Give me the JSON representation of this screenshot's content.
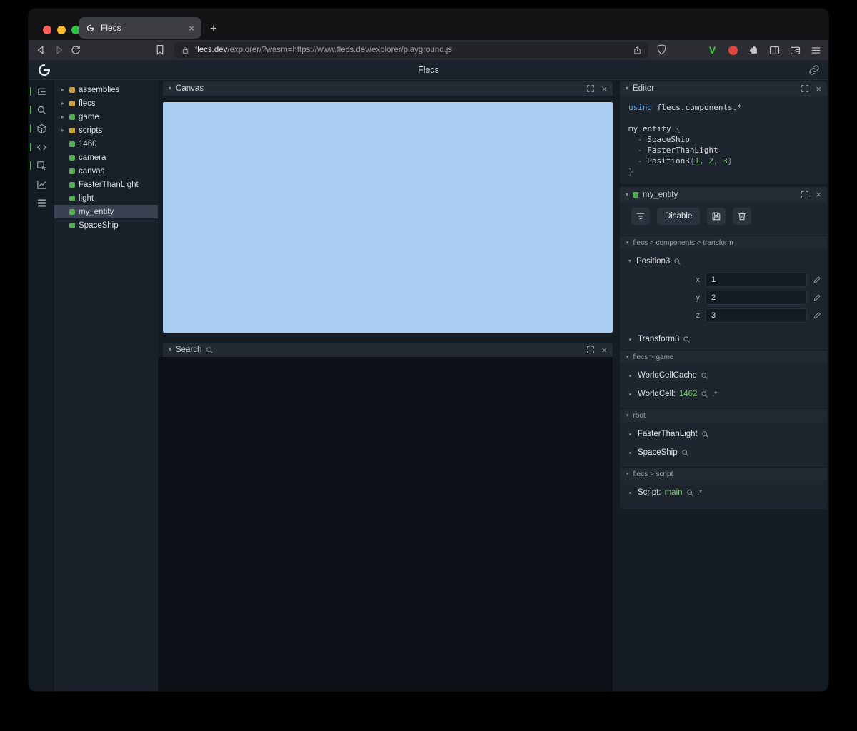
{
  "colors": {
    "canvas_blue": "#a8cdf1",
    "accent_green": "#57a957",
    "module_yellow": "#c7a03c",
    "value_green": "#79c46e",
    "keyword_blue": "#57a8f2"
  },
  "glyphs": {
    "close": "×",
    "plus": "+",
    "caret_down": "▾",
    "caret_right": "▸"
  },
  "browser": {
    "tab_title": "Flecs",
    "url_domain": "flecs.dev",
    "url_path": "/explorer/?wasm=https://www.flecs.dev/explorer/playground.js",
    "v_badge": "V"
  },
  "app": {
    "title": "Flecs"
  },
  "tree": {
    "items": [
      {
        "label": "assemblies",
        "expandable": true,
        "sq": "background:#c7a03c"
      },
      {
        "label": "flecs",
        "expandable": true,
        "sq": "background:#c7a03c"
      },
      {
        "label": "game",
        "expandable": true,
        "sq": "background:#57a957"
      },
      {
        "label": "scripts",
        "expandable": true,
        "sq": "background:#c7a03c"
      },
      {
        "label": "1460",
        "sq": "background:#57a957"
      },
      {
        "label": "camera",
        "sq": "background:#57a957"
      },
      {
        "label": "canvas",
        "sq": "background:#57a957"
      },
      {
        "label": "FasterThanLight",
        "sq": "background:#57a957"
      },
      {
        "label": "light",
        "sq": "background:#57a957"
      },
      {
        "label": "my_entity",
        "selected": true,
        "sq": "background:#57a957"
      },
      {
        "label": "SpaceShip",
        "sq": "background:#57a957"
      }
    ]
  },
  "panels": {
    "canvas": {
      "title": "Canvas"
    },
    "search": {
      "title": "Search"
    },
    "editor": {
      "title": "Editor"
    },
    "inspector": {
      "title": "my_entity"
    }
  },
  "code": {
    "l1_kw": "using",
    "l1_rest": " flecs.components.*",
    "l3_name": "my_entity",
    "l3_open": " {",
    "dash": "-",
    "l4": "SpaceShip",
    "l5": "FasterThanLight",
    "l6_name": "Position3",
    "l6_open": "{",
    "l6_nums": "1, 2, 3",
    "l6_close": "}",
    "l7_close": "}"
  },
  "inspector": {
    "disable_label": "Disable",
    "sections": {
      "transform": "flecs > components > transform",
      "game": "flecs > game",
      "root": "root",
      "script": "flecs > script"
    },
    "position3_name": "Position3",
    "fields": [
      {
        "k": "x",
        "v": "1"
      },
      {
        "k": "y",
        "v": "2"
      },
      {
        "k": "z",
        "v": "3"
      }
    ],
    "transform3_name": "Transform3",
    "worldcellcache_name": "WorldCellCache",
    "worldcell_label": "WorldCell:",
    "worldcell_value": "1462",
    "pair_suffix": ".*",
    "root_item_1": "FasterThanLight",
    "root_item_2": "SpaceShip",
    "script_label": "Script:",
    "script_value": "main"
  }
}
